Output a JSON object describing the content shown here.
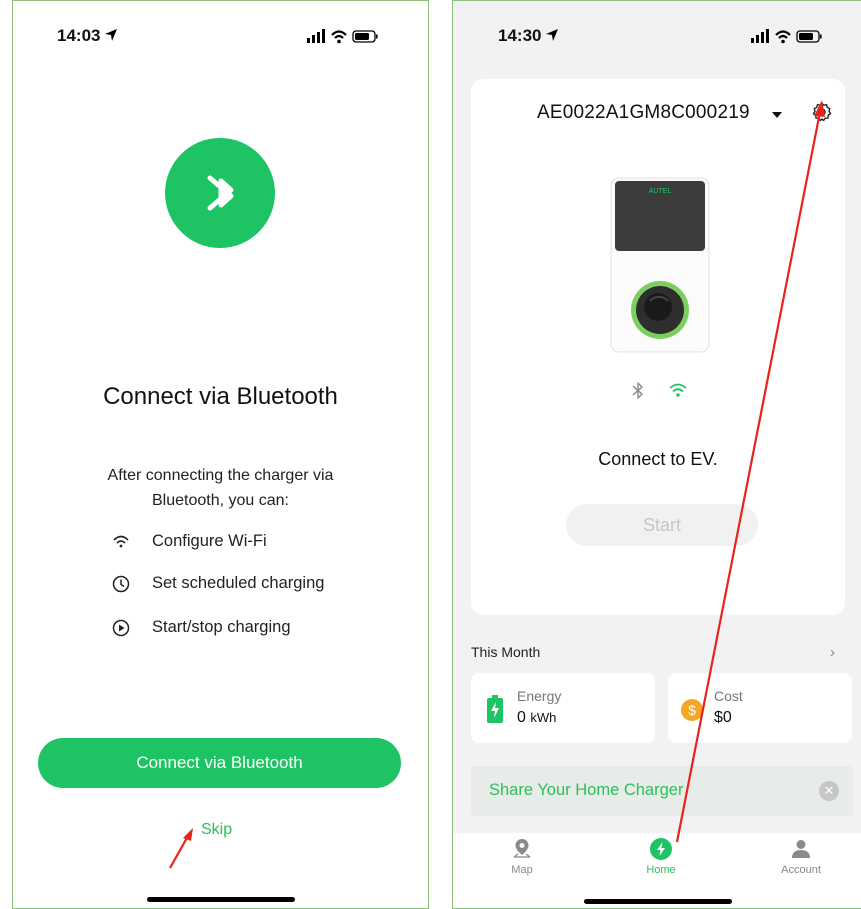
{
  "accent_color": "#1ec463",
  "annotation_color": "#e8231a",
  "left_screen": {
    "status_time": "14:03",
    "icon": "bluetooth-icon",
    "title": "Connect via Bluetooth",
    "description": "After connecting the charger via Bluetooth, you can:",
    "features": [
      {
        "icon": "wifi-icon",
        "label": "Configure Wi-Fi"
      },
      {
        "icon": "clock-icon",
        "label": "Set scheduled charging"
      },
      {
        "icon": "play-circle-icon",
        "label": "Start/stop charging"
      }
    ],
    "primary_button": "Connect via Bluetooth",
    "skip_link": "Skip"
  },
  "right_screen": {
    "status_time": "14:30",
    "device_name": "AE0022A1GM8C000219",
    "charger_brand": "AUTEL",
    "status_text": "Connect to EV.",
    "start_button": "Start",
    "month_section": {
      "title": "This Month",
      "energy": {
        "label": "Energy",
        "value": "0",
        "unit": "kWh"
      },
      "cost": {
        "label": "Cost",
        "value": "$0"
      }
    },
    "share_banner": "Share Your Home Charger",
    "tabs": [
      {
        "label": "Map",
        "icon": "map-pin-icon",
        "active": false
      },
      {
        "label": "Home",
        "icon": "bolt-icon",
        "active": true
      },
      {
        "label": "Account",
        "icon": "person-icon",
        "active": false
      }
    ]
  }
}
